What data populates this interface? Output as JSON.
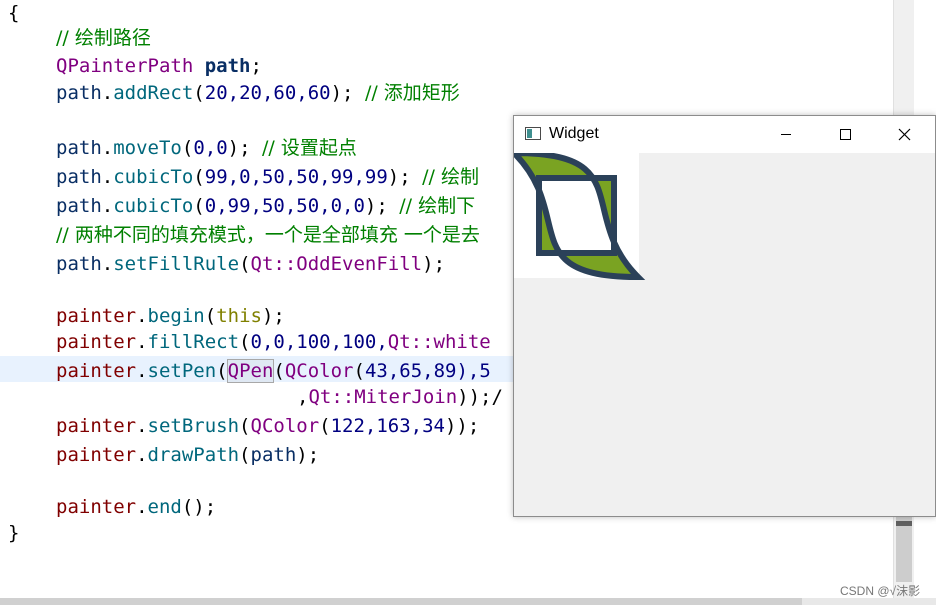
{
  "code": {
    "l0": {
      "brace": "{"
    },
    "l1": {
      "comment": "// 绘制路径"
    },
    "l2": {
      "type": "QPainterPath",
      "var": "path",
      "end": ";"
    },
    "l3": {
      "obj": "path",
      "dot": ".",
      "fn": "addRect",
      "open": "(",
      "args": "20,20,60,60",
      "close": ");",
      "comment": "// 添加矩形"
    },
    "l4": {
      "obj": "path",
      "dot": ".",
      "fn": "moveTo",
      "open": "(",
      "args": "0,0",
      "close": ");",
      "comment": "// 设置起点"
    },
    "l5": {
      "obj": "path",
      "dot": ".",
      "fn": "cubicTo",
      "open": "(",
      "args": "99,0,50,50,99,99",
      "close": ");",
      "comment": "// 绘制"
    },
    "l6": {
      "obj": "path",
      "dot": ".",
      "fn": "cubicTo",
      "open": "(",
      "args": "0,99,50,50,0,0",
      "close": ");",
      "comment": "// 绘制下"
    },
    "l7": {
      "comment": "// 两种不同的填充模式，一个是全部填充 一个是去"
    },
    "l8": {
      "obj": "path",
      "dot": ".",
      "fn": "setFillRule",
      "open": "(",
      "ns": "Qt::",
      "enum": "OddEvenFill",
      "close": ");"
    },
    "l9": {
      "obj": "painter",
      "dot": ".",
      "fn": "begin",
      "open": "(",
      "kw": "this",
      "close": ");"
    },
    "l10": {
      "obj": "painter",
      "dot": ".",
      "fn": "fillRect",
      "open": "(",
      "args": "0,0,100,100,",
      "ns": "Qt::",
      "enum": "white"
    },
    "l11": {
      "obj": "painter",
      "dot": ".",
      "fn": "setPen",
      "open": "(",
      "qpen": "QPen",
      "open2": "(",
      "qcolor": "QColor",
      "open3": "(",
      "args": "43,65,89",
      "tail": "),5"
    },
    "l12": {
      "lead": ",",
      "ns": "Qt::",
      "enum": "MiterJoin",
      "close": "));/"
    },
    "l13": {
      "obj": "painter",
      "dot": ".",
      "fn": "setBrush",
      "open": "(",
      "qcolor": "QColor",
      "open2": "(",
      "args": "122,163,34",
      "close": "));"
    },
    "l14": {
      "obj": "painter",
      "dot": ".",
      "fn": "drawPath",
      "open": "(",
      "arg": "path",
      "close": ");"
    },
    "l15": {
      "obj": "painter",
      "dot": ".",
      "fn": "end",
      "close": "();"
    },
    "l16": {
      "brace": "}"
    }
  },
  "widget": {
    "title": "Widget",
    "minimize": "minimize-icon",
    "maximize": "maximize-icon",
    "close": "close-icon"
  },
  "colors": {
    "pen": "#2b4159",
    "brush": "#7aa322",
    "canvas_bg": "#ffffff"
  },
  "watermark": "CSDN @√沫影"
}
